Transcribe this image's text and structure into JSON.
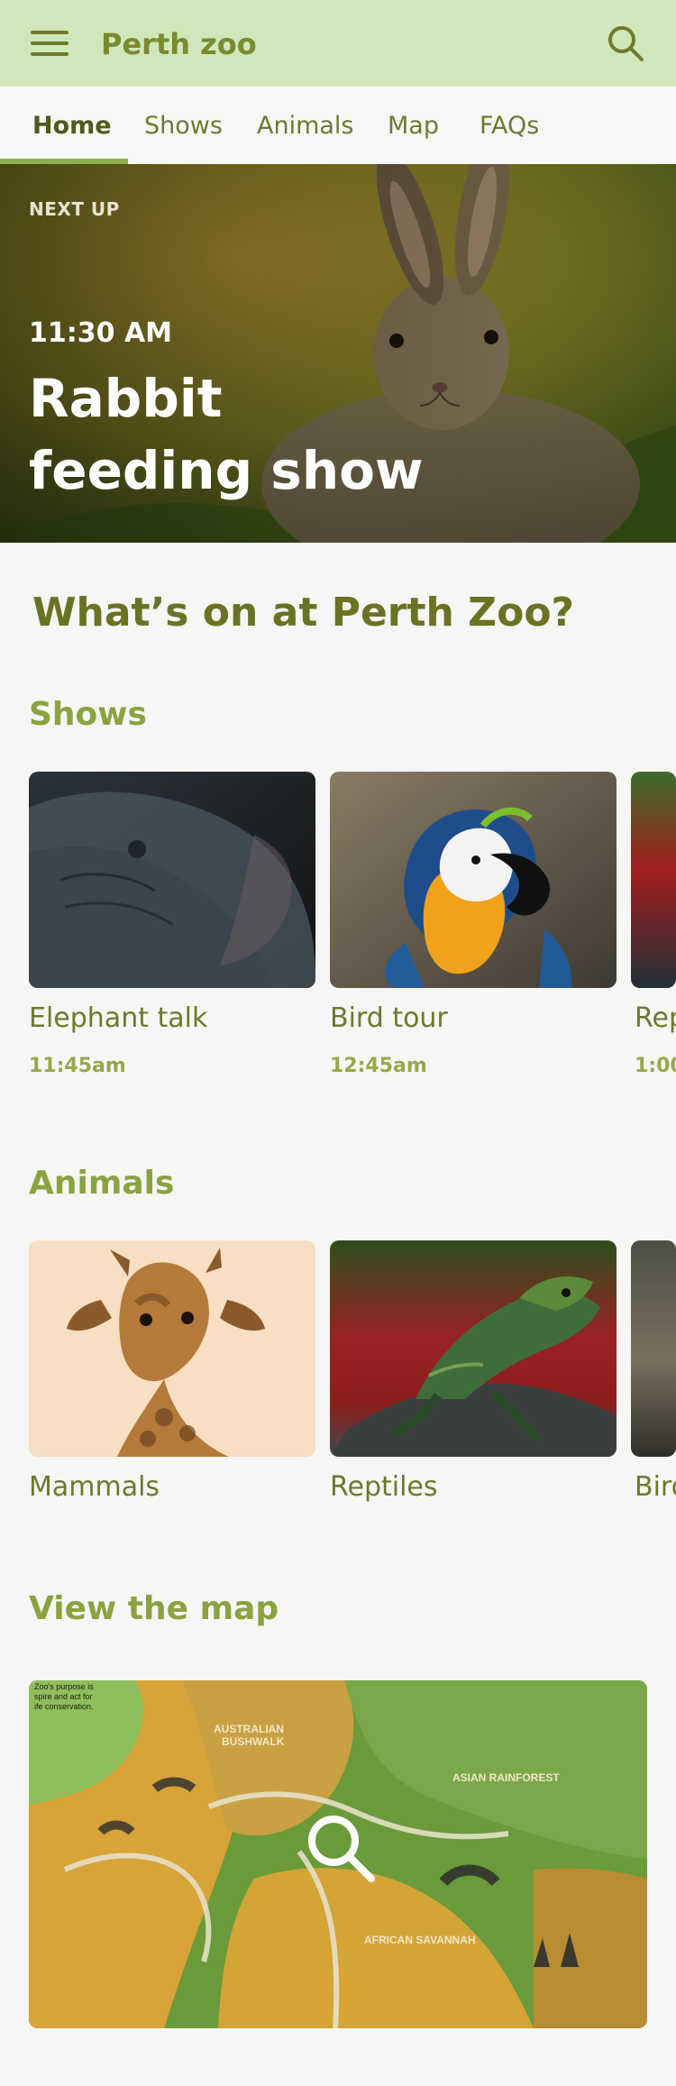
{
  "app": {
    "title": "Perth zoo",
    "icons": {
      "menu": "menu-icon",
      "search": "search-icon"
    },
    "colors": {
      "appbar": "#cfe8bb",
      "accent": "#8aa23f",
      "text": "#6b7a2d"
    }
  },
  "tabs": [
    {
      "label": "Home",
      "active": true
    },
    {
      "label": "Shows",
      "active": false
    },
    {
      "label": "Animals",
      "active": false
    },
    {
      "label": "Map",
      "active": false
    },
    {
      "label": "FAQs",
      "active": false
    }
  ],
  "hero": {
    "eyebrow": "NEXT UP",
    "time": "11:30 AM",
    "title": "Rabbit feeding show"
  },
  "page_heading": "What’s on at Perth Zoo?",
  "shows": {
    "title": "Shows",
    "items": [
      {
        "label": "Elephant talk",
        "time": "11:45am"
      },
      {
        "label": "Bird tour",
        "time": "12:45am"
      },
      {
        "label": "Rep",
        "time": "1:00"
      }
    ]
  },
  "animals": {
    "title": "Animals",
    "items": [
      {
        "label": "Mammals"
      },
      {
        "label": "Reptiles"
      },
      {
        "label": "Bird"
      }
    ]
  },
  "map_section": {
    "title": "View the map",
    "map_text": {
      "corner": "Zoo's purpose is\nspire and act for\nife conservation.",
      "australian": "AUSTRALIAN\nBUSHWALK",
      "asian": "ASIAN RAINFOREST",
      "african": "AFRICAN SAVANNAH"
    },
    "icons": {
      "zoom": "search-icon"
    }
  }
}
